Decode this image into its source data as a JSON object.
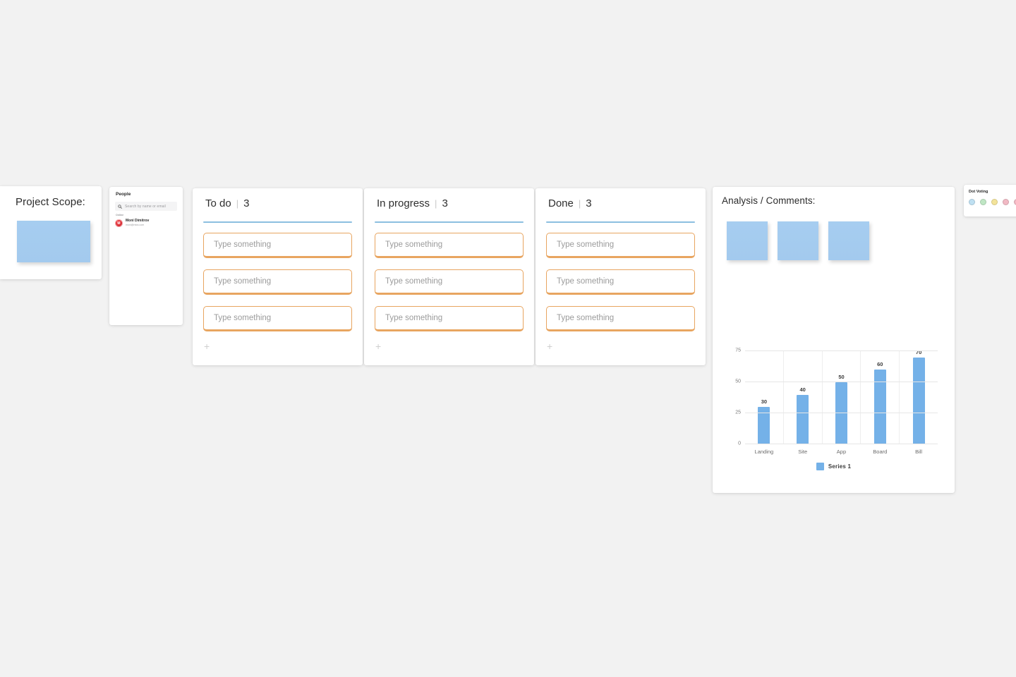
{
  "project_scope": {
    "title": "Project Scope:",
    "sticky_color": "#a6cdf0"
  },
  "people": {
    "title": "People",
    "search_placeholder": "Search by name or email",
    "search_value": "",
    "group_label": "Online",
    "members": [
      {
        "initial": "M",
        "name": "Moni Dimitrov",
        "email": "moni@mira.com",
        "avatar_color": "#d3262e"
      }
    ]
  },
  "board": {
    "columns": [
      {
        "title": "To do",
        "separator": "|",
        "count": "3",
        "add_label": "+",
        "cards": [
          {
            "placeholder": "Type something",
            "value": ""
          },
          {
            "placeholder": "Type something",
            "value": ""
          },
          {
            "placeholder": "Type something",
            "value": ""
          }
        ]
      },
      {
        "title": "In progress",
        "separator": "|",
        "count": "3",
        "add_label": "+",
        "cards": [
          {
            "placeholder": "Type something",
            "value": ""
          },
          {
            "placeholder": "Type something",
            "value": ""
          },
          {
            "placeholder": "Type something",
            "value": ""
          }
        ]
      },
      {
        "title": "Done",
        "separator": "|",
        "count": "3",
        "add_label": "+",
        "cards": [
          {
            "placeholder": "Type something",
            "value": ""
          },
          {
            "placeholder": "Type something",
            "value": ""
          },
          {
            "placeholder": "Type something",
            "value": ""
          }
        ]
      }
    ],
    "accent_rule_color": "#8cbfe0",
    "card_border_color": "#e8a560"
  },
  "analysis": {
    "title": "Analysis / Comments:",
    "stickies": [
      {
        "color": "#a6cdf0"
      },
      {
        "color": "#a6cdf0"
      },
      {
        "color": "#a6cdf0"
      }
    ]
  },
  "dot_voting": {
    "title": "Dot Voting",
    "dots": [
      {
        "name": "blue",
        "color": "#bfe0f2"
      },
      {
        "name": "green",
        "color": "#bfe6c4"
      },
      {
        "name": "yellow",
        "color": "#f3e39a"
      },
      {
        "name": "pink",
        "color": "#f1b9c4"
      },
      {
        "name": "pink-2",
        "color": "#f1b9c4"
      }
    ]
  },
  "chart_data": {
    "type": "bar",
    "title": "",
    "categories": [
      "Landing",
      "Site",
      "App",
      "Board",
      "Bill"
    ],
    "values": [
      30,
      40,
      50,
      60,
      70
    ],
    "series": [
      {
        "name": "Series 1",
        "values": [
          30,
          40,
          50,
          60,
          70
        ],
        "color": "#74b1e8"
      }
    ],
    "data_labels": [
      "30",
      "40",
      "50",
      "60",
      "70"
    ],
    "xlabel": "",
    "ylabel": "",
    "ylim": [
      0,
      75
    ],
    "yticks": [
      0,
      25,
      50,
      75
    ],
    "ytick_labels": [
      "0",
      "25",
      "50",
      "75"
    ],
    "grid": true,
    "legend_position": "bottom",
    "legend": [
      "Series 1"
    ]
  }
}
